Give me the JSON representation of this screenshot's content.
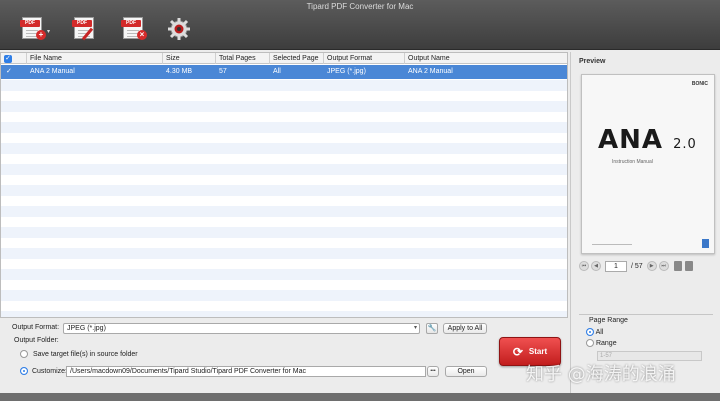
{
  "window": {
    "title": "Tipard PDF Converter for Mac"
  },
  "toolbar": {
    "add_pdf": "PDF",
    "edit_pdf": "PDF",
    "remove_pdf": "PDF"
  },
  "table": {
    "columns": [
      "File Name",
      "Size",
      "Total Pages",
      "Selected Page",
      "Output Format",
      "Output Name"
    ],
    "rows": [
      {
        "checked": true,
        "file_name": "ANA 2 Manual",
        "size": "4.30 MB",
        "total_pages": "57",
        "selected_page": "All",
        "output_format": "JPEG (*.jpg)",
        "output_name": "ANA 2 Manual"
      }
    ]
  },
  "preview": {
    "label": "Preview",
    "brand": "BONIC",
    "title": "ANA",
    "version": "2.0",
    "subtitle": "Instruction Manual",
    "current_page": "1",
    "total_pages": "/ 57"
  },
  "page_range": {
    "title": "Page Range",
    "all_label": "All",
    "range_label": "Range",
    "range_placeholder": "1-57",
    "selected": "All"
  },
  "output": {
    "format_label": "Output Format:",
    "format_value": "JPEG (*.jpg)",
    "apply_all": "Apply to All",
    "folder_label": "Output Folder:",
    "save_source": "Save target file(s) in source folder",
    "customize": "Customize:",
    "path": "/Users/macdown09/Documents/Tipard Studio/Tipard PDF Converter for Mac",
    "more": "•••",
    "open": "Open",
    "selected_option": "Customize"
  },
  "start": {
    "label": "Start"
  },
  "watermark": "知乎 @海涛的浪涌",
  "colors": {
    "accent": "#2f7ee6",
    "selection": "#4a87d6",
    "start": "#d42a2a"
  }
}
